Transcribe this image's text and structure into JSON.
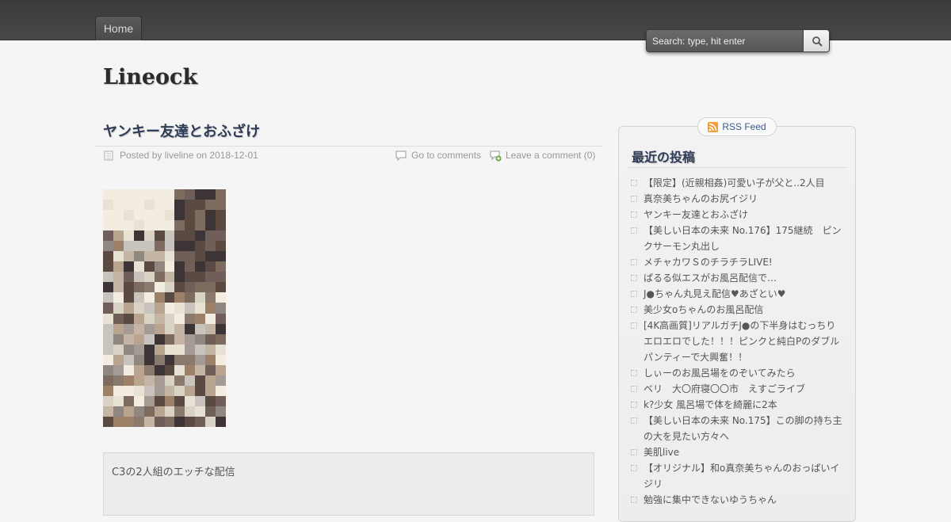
{
  "nav": {
    "home_label": "Home"
  },
  "search": {
    "placeholder": "Search: type, hit enter",
    "icon": "search-icon"
  },
  "site": {
    "title": "Lineock"
  },
  "post": {
    "title": "ヤンキー友達とおふざけ",
    "posted_by": "Posted by liveline on 2018-12-01",
    "comments_link": "Go to comments",
    "leave_comment": "Leave a comment (0)",
    "excerpt": "C3の2人組のエッチな配信"
  },
  "sidebar": {
    "rss_label": "RSS Feed",
    "widget_title": "最近の投稿",
    "recent_posts": [
      "【限定】(近親相姦)可愛い子が父と..2人目",
      "真奈美ちゃんのお尻イジリ",
      "ヤンキー友達とおふざけ",
      "【美しい日本の未来 No.176】175継続　ピンクサーモン丸出し",
      "メチャカワＳのチラチラLIVE!",
      "ぱるる似エスがお風呂配信で…",
      "J●ちゃん丸見え配信♥あざとい♥",
      "美少女oちゃんのお風呂配信",
      "[4K高画質]リアルガチJ●の下半身はむっちりエロエロでした！！！ピンクと純白Pのダブルパンティーで大興奮！！",
      "しぃーのお風呂場をのぞいてみたら",
      "ベリ　大〇府寝〇〇市　えすごライブ",
      "k?少女 風呂場で体を綺麗に2本",
      "【美しい日本の未来 No.175】この脚の持ち主の大を見たい方々へ",
      "美肌live",
      "【オリジナル】和o真奈美ちゃんのおっぱいイジリ",
      "勉強に集中できないゆうちゃん"
    ]
  }
}
